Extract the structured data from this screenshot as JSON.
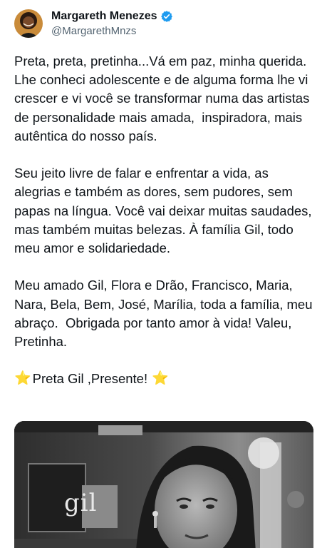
{
  "author": {
    "display_name": "Margareth Menezes",
    "handle": "@MargarethMnzs",
    "verified": true,
    "avatar_icon": "profile-photo",
    "verified_icon": "verified-badge-icon",
    "verified_color": "#1d9bf0"
  },
  "tweet": {
    "paragraphs": [
      "Preta, preta, pretinha...Vá em paz, minha querida. Lhe conheci adolescente e de alguma forma lhe vi crescer e vi você se transformar numa das artistas de personalidade mais amada,  inspiradora, mais autêntica do nosso país.",
      "Seu jeito livre de falar e enfrentar a vida, as alegrias e também as dores, sem pudores, sem papas na língua. Você vai deixar muitas saudades, mas também muitas belezas. À família Gil, todo meu amor e solidariedade.",
      "Meu amado Gil, Flora e Drão, Francisco, Maria, Nara, Bela, Bem, José, Marília, toda a família, meu abraço.  Obrigada por tanto amor à vida! Valeu, Pretinha."
    ],
    "closing_star_left": "⭐",
    "closing_text": "Preta Gil ,Presente!",
    "closing_star_right": "⭐"
  },
  "media": {
    "kind": "photo",
    "sign_text": "gil"
  }
}
